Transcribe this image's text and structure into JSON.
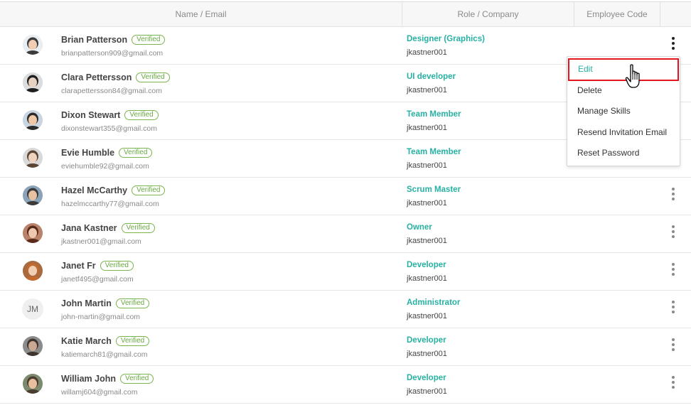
{
  "header": {
    "name_email": "Name / Email",
    "role_company": "Role / Company",
    "employee_code": "Employee Code"
  },
  "badge_label": "Verified",
  "rows": [
    {
      "name": "Brian Patterson",
      "email": "brianpatterson909@gmail.com",
      "role": "Designer (Graphics)",
      "company": "jkastner001",
      "avatar": "photo"
    },
    {
      "name": "Clara Pettersson",
      "email": "clarapettersson84@gmail.com",
      "role": "UI developer",
      "company": "jkastner001",
      "avatar": "photo"
    },
    {
      "name": "Dixon Stewart",
      "email": "dixonstewart355@gmail.com",
      "role": "Team Member",
      "company": "jkastner001",
      "avatar": "photo"
    },
    {
      "name": "Evie Humble",
      "email": "eviehumble92@gmail.com",
      "role": "Team Member",
      "company": "jkastner001",
      "avatar": "photo"
    },
    {
      "name": "Hazel McCarthy",
      "email": "hazelmccarthy77@gmail.com",
      "role": "Scrum Master",
      "company": "jkastner001",
      "avatar": "photo"
    },
    {
      "name": "Jana Kastner",
      "email": "jkastner001@gmail.com",
      "role": "Owner",
      "company": "jkastner001",
      "avatar": "photo"
    },
    {
      "name": "Janet Fr",
      "email": "janetf495@gmail.com",
      "role": "Developer",
      "company": "jkastner001",
      "avatar": "photo"
    },
    {
      "name": "John Martin",
      "email": "john-martin@gmail.com",
      "role": "Administrator",
      "company": "jkastner001",
      "avatar": "initials",
      "initials": "JM"
    },
    {
      "name": "Katie March",
      "email": "katiemarch81@gmail.com",
      "role": "Developer",
      "company": "jkastner001",
      "avatar": "photo"
    },
    {
      "name": "William John",
      "email": "willamj604@gmail.com",
      "role": "Developer",
      "company": "jkastner001",
      "avatar": "photo"
    }
  ],
  "context_menu": {
    "items": [
      "Edit",
      "Delete",
      "Manage Skills",
      "Resend Invitation Email",
      "Reset Password"
    ],
    "highlighted": "Edit"
  },
  "colors": {
    "accent_teal": "#27b1a3",
    "verified_green": "#6aa843",
    "highlight_red": "#e3161f"
  },
  "icons": {
    "row_actions": "kebab-menu-icon",
    "cursor": "hand-pointer-icon"
  }
}
